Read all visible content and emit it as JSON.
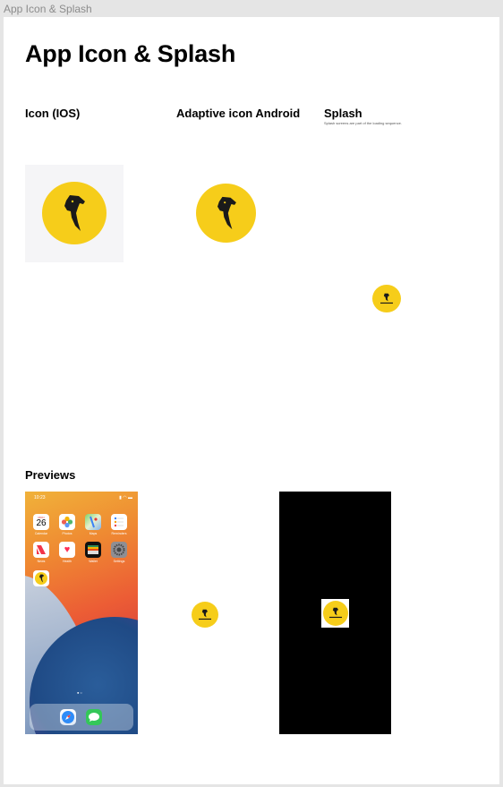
{
  "window": {
    "frame_label": "App Icon & Splash"
  },
  "page": {
    "title": "App Icon & Splash"
  },
  "sections": {
    "icon_ios": {
      "title": "Icon (IOS)"
    },
    "adaptive_android": {
      "title": "Adaptive icon Android"
    },
    "splash": {
      "title": "Splash",
      "subtitle": "Splash screens are part of the loading sequence."
    },
    "previews": {
      "title": "Previews"
    }
  },
  "phone": {
    "time": "10:23",
    "status_icons": "▮ ◠ ▬",
    "calendar": {
      "day_label": "MON",
      "day": "26"
    },
    "apps": [
      {
        "label": "Calendar",
        "icon": "calendar-icon"
      },
      {
        "label": "Photos",
        "icon": "photos-icon"
      },
      {
        "label": "Maps",
        "icon": "maps-icon"
      },
      {
        "label": "Reminders",
        "icon": "reminders-icon"
      },
      {
        "label": "News",
        "icon": "news-icon"
      },
      {
        "label": "Health",
        "icon": "health-icon"
      },
      {
        "label": "Wallet",
        "icon": "wallet-icon"
      },
      {
        "label": "Settings",
        "icon": "settings-icon"
      }
    ],
    "dock_apps": [
      {
        "icon": "safari-icon"
      },
      {
        "icon": "messages-icon"
      }
    ],
    "page_dots": "●○"
  },
  "colors": {
    "brand_yellow": "#f6cd1a",
    "logo_dark": "#1a1a1a",
    "frame_bg": "#e5e5e5"
  },
  "logo": {
    "icon": "dragon-head-logo"
  }
}
